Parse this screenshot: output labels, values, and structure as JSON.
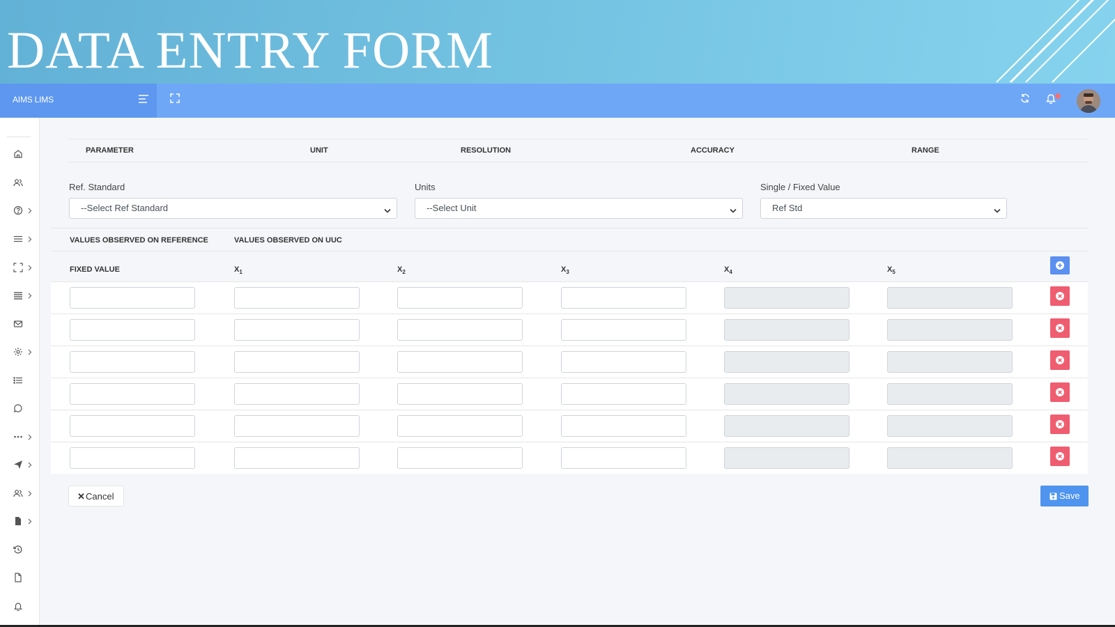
{
  "banner": {
    "title": "DATA ENTRY FORM"
  },
  "topbar": {
    "brand": "AIMS LIMS"
  },
  "sidebar": {
    "items": [
      {
        "icon": "home-icon"
      },
      {
        "icon": "users-icon"
      },
      {
        "icon": "help-icon"
      },
      {
        "icon": "menu-icon"
      },
      {
        "icon": "expand-icon"
      },
      {
        "icon": "list-icon"
      },
      {
        "icon": "mail-icon"
      },
      {
        "icon": "gear-icon"
      },
      {
        "icon": "bullet-list-icon"
      },
      {
        "icon": "chat-icon"
      },
      {
        "icon": "more-icon"
      },
      {
        "icon": "send-icon"
      },
      {
        "icon": "group-icon"
      },
      {
        "icon": "file-icon"
      },
      {
        "icon": "history-icon"
      },
      {
        "icon": "document-icon"
      },
      {
        "icon": "bell-icon"
      }
    ]
  },
  "param_header": {
    "parameter": "PARAMETER",
    "unit": "UNIT",
    "resolution": "RESOLUTION",
    "accuracy": "ACCURACY",
    "range": "RANGE"
  },
  "fields": {
    "ref_standard": {
      "label": "Ref. Standard",
      "value": "--Select Ref Standard"
    },
    "units": {
      "label": "Units",
      "value": "--Select Unit"
    },
    "single_fixed": {
      "label": "Single / Fixed Value",
      "value": "Ref Std"
    }
  },
  "observed": {
    "on_reference": "VALUES OBSERVED ON REFERENCE",
    "on_uuc": "VALUES OBSERVED ON UUC"
  },
  "columns": {
    "fixed_value": "FIXED VALUE",
    "x1": "X",
    "x1_sub": "1",
    "x2": "X",
    "x2_sub": "2",
    "x3": "X",
    "x3_sub": "3",
    "x4": "X",
    "x4_sub": "4",
    "x5": "X",
    "x5_sub": "5"
  },
  "rows": [
    {
      "fixed_value": "",
      "x1": "",
      "x2": "",
      "x3": "",
      "x4": "",
      "x5": ""
    },
    {
      "fixed_value": "",
      "x1": "",
      "x2": "",
      "x3": "",
      "x4": "",
      "x5": ""
    },
    {
      "fixed_value": "",
      "x1": "",
      "x2": "",
      "x3": "",
      "x4": "",
      "x5": ""
    },
    {
      "fixed_value": "",
      "x1": "",
      "x2": "",
      "x3": "",
      "x4": "",
      "x5": ""
    },
    {
      "fixed_value": "",
      "x1": "",
      "x2": "",
      "x3": "",
      "x4": "",
      "x5": ""
    },
    {
      "fixed_value": "",
      "x1": "",
      "x2": "",
      "x3": "",
      "x4": "",
      "x5": ""
    }
  ],
  "actions": {
    "cancel": "Cancel",
    "save": "Save"
  },
  "colors": {
    "topbar": "#6fa7f7",
    "brand": "#5d97f0",
    "add": "#5b8ff0",
    "delete": "#ef5d70",
    "save": "#4f94ef"
  }
}
